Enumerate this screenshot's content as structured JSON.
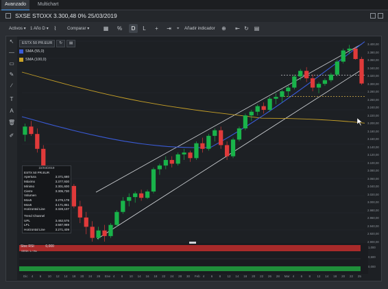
{
  "tabs": [
    "Avanzado",
    "Multichart"
  ],
  "title": "SXSE STOXX 3.300,48 0% 25/03/2019",
  "toolbar": {
    "activos": "Activos",
    "periodo": "1 Año D",
    "comparar": "Comparar",
    "d": "D",
    "l": "L",
    "anadir": "Añadir indicador"
  },
  "legend": {
    "symbol": "ESTX 50 PR.EUR",
    "sma1": "SMA (55,0)",
    "sma2": "SMA (100,0)",
    "sma1_color": "#3a5bd8",
    "sma2_color": "#c9a227"
  },
  "info": {
    "date": "22/03/2019",
    "symbol": "ESTX 50 PR.EUR",
    "rows": [
      {
        "k": "Apertura",
        "v": "3.371,680"
      },
      {
        "k": "Máximo",
        "v": "3.377,930"
      },
      {
        "k": "Mínimo",
        "v": "3.301,600"
      },
      {
        "k": "Cierre",
        "v": "3.305,730"
      },
      {
        "k": "Volumen",
        "v": ""
      },
      {
        "k": "Mov5",
        "v": "3.276,178"
      },
      {
        "k": "Mov5",
        "v": "3.171,851"
      },
      {
        "k": "Horizontal Line",
        "v": "3.328,107"
      }
    ],
    "trend_title": "Trend Channel",
    "trend": [
      {
        "k": "UPL",
        "v": "3.462,575"
      },
      {
        "k": "LPL",
        "v": "3.587,989"
      },
      {
        "k": "Horizontal Line",
        "v": "3.271,409"
      }
    ]
  },
  "yaxis": [
    "3.400,00",
    "3.380,00",
    "3.360,00",
    "3.340,00",
    "3.320,00",
    "3.300,00",
    "3.280,00",
    "3.260,00",
    "3.240,00",
    "3.220,00",
    "3.200,00",
    "3.180,00",
    "3.160,00",
    "3.140,00",
    "3.120,00",
    "3.100,00",
    "3.080,00",
    "3.060,00",
    "3.040,00",
    "3.020,00",
    "3.000,00",
    "2.980,00",
    "2.960,00",
    "2.940,00",
    "2.920,00",
    "2.900,00"
  ],
  "xaxis": [
    "Dic",
    "4",
    "6",
    "10",
    "12",
    "14",
    "18",
    "20",
    "24",
    "28",
    "Ene",
    "4",
    "8",
    "10",
    "14",
    "16",
    "18",
    "22",
    "24",
    "28",
    "30",
    "Feb",
    "4",
    "6",
    "8",
    "12",
    "14",
    "18",
    "20",
    "22",
    "26",
    "28",
    "Mar",
    "4",
    "6",
    "8",
    "12",
    "14",
    "18",
    "20",
    "22",
    "25"
  ],
  "sub": {
    "label": "Stoc RSI",
    "value": "0,000",
    "sublabel": "SRSK 1 / Ho",
    "ylabels": [
      "1,000",
      "0,500",
      "0,000"
    ]
  },
  "chart_data": {
    "type": "candlestick",
    "series": [
      {
        "name": "ESTX 50 PR.EUR",
        "ohlc": [
          [
            3168,
            3198,
            3150,
            3190
          ],
          [
            3190,
            3205,
            3165,
            3170
          ],
          [
            3170,
            3185,
            3120,
            3130
          ],
          [
            3130,
            3140,
            3050,
            3060
          ],
          [
            3060,
            3070,
            3020,
            3035
          ],
          [
            3035,
            3040,
            2980,
            2990
          ],
          [
            2990,
            3010,
            2960,
            3000
          ],
          [
            3000,
            3040,
            2995,
            3030
          ],
          [
            3030,
            3035,
            2970,
            2975
          ],
          [
            2975,
            2990,
            2930,
            2945
          ],
          [
            2945,
            2960,
            2900,
            2920
          ],
          [
            2920,
            2935,
            2880,
            2890
          ],
          [
            2890,
            2920,
            2885,
            2910
          ],
          [
            2910,
            2925,
            2880,
            2895
          ],
          [
            2895,
            2930,
            2890,
            2925
          ],
          [
            2925,
            2965,
            2920,
            2960
          ],
          [
            2960,
            3000,
            2955,
            2990
          ],
          [
            2990,
            3010,
            2975,
            3000
          ],
          [
            3000,
            3015,
            2985,
            3010
          ],
          [
            3010,
            3020,
            2990,
            2998
          ],
          [
            2998,
            3020,
            2995,
            3015
          ],
          [
            3015,
            3080,
            3010,
            3075
          ],
          [
            3075,
            3090,
            3060,
            3085
          ],
          [
            3085,
            3110,
            3075,
            3100
          ],
          [
            3100,
            3110,
            3080,
            3090
          ],
          [
            3090,
            3120,
            3085,
            3115
          ],
          [
            3115,
            3130,
            3100,
            3120
          ],
          [
            3120,
            3125,
            3095,
            3105
          ],
          [
            3105,
            3150,
            3100,
            3145
          ],
          [
            3145,
            3160,
            3120,
            3130
          ],
          [
            3130,
            3170,
            3125,
            3165
          ],
          [
            3165,
            3185,
            3150,
            3180
          ],
          [
            3180,
            3190,
            3130,
            3140
          ],
          [
            3140,
            3150,
            3100,
            3110
          ],
          [
            3110,
            3160,
            3105,
            3155
          ],
          [
            3155,
            3190,
            3150,
            3185
          ],
          [
            3185,
            3225,
            3180,
            3220
          ],
          [
            3220,
            3235,
            3205,
            3230
          ],
          [
            3230,
            3250,
            3220,
            3245
          ],
          [
            3245,
            3255,
            3225,
            3235
          ],
          [
            3235,
            3270,
            3230,
            3265
          ],
          [
            3265,
            3280,
            3250,
            3270
          ],
          [
            3270,
            3290,
            3255,
            3285
          ],
          [
            3285,
            3300,
            3270,
            3295
          ],
          [
            3295,
            3330,
            3290,
            3325
          ],
          [
            3325,
            3345,
            3315,
            3340
          ],
          [
            3340,
            3350,
            3310,
            3320
          ],
          [
            3320,
            3330,
            3285,
            3295
          ],
          [
            3295,
            3310,
            3280,
            3305
          ],
          [
            3305,
            3320,
            3300,
            3315
          ],
          [
            3315,
            3335,
            3310,
            3330
          ],
          [
            3330,
            3370,
            3325,
            3365
          ],
          [
            3365,
            3400,
            3360,
            3395
          ],
          [
            3395,
            3410,
            3385,
            3400
          ],
          [
            3400,
            3405,
            3370,
            3372
          ],
          [
            3372,
            3378,
            3302,
            3306
          ]
        ]
      }
    ],
    "indicators": [
      "SMA (55,0)",
      "SMA (100,0)"
    ],
    "horizontal_lines": [
      3328.107,
      3271.409
    ]
  }
}
